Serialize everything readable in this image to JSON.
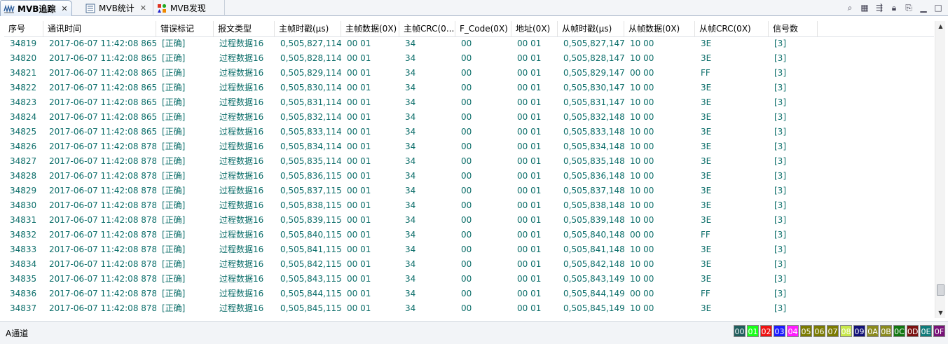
{
  "tabs": [
    {
      "label": "MVB追踪",
      "icon": "trace-wave-icon",
      "active": true
    },
    {
      "label": "MVB统计",
      "icon": "statistics-table-icon",
      "active": false
    },
    {
      "label": "MVB发现",
      "icon": "discovery-nodes-icon",
      "active": false
    }
  ],
  "toolbar_icons": [
    "search-icon",
    "table-view-icon",
    "filter-icon",
    "lock-icon",
    "export-icon",
    "minimize-icon",
    "maximize-icon"
  ],
  "columns": [
    "序号",
    "通讯时间",
    "错误标记",
    "报文类型",
    "主帧时戳(μs)",
    "主帧数据(0X)",
    "主帧CRC(0...",
    "F_Code(0X)",
    "地址(0X)",
    "从帧时戳(μs)",
    "从帧数据(0X)",
    "从帧CRC(0X)",
    "信号数"
  ],
  "rows": [
    [
      "34819",
      "2017-06-07 11:42:08 865",
      "[正确]",
      "过程数据16",
      "0,505,827,114",
      "00 01",
      "34",
      "00",
      "00 01",
      "0,505,827,147",
      "10 00",
      "3E",
      "[3]"
    ],
    [
      "34820",
      "2017-06-07 11:42:08 865",
      "[正确]",
      "过程数据16",
      "0,505,828,114",
      "00 01",
      "34",
      "00",
      "00 01",
      "0,505,828,147",
      "10 00",
      "3E",
      "[3]"
    ],
    [
      "34821",
      "2017-06-07 11:42:08 865",
      "[正确]",
      "过程数据16",
      "0,505,829,114",
      "00 01",
      "34",
      "00",
      "00 01",
      "0,505,829,147",
      "00 00",
      "FF",
      "[3]"
    ],
    [
      "34822",
      "2017-06-07 11:42:08 865",
      "[正确]",
      "过程数据16",
      "0,505,830,114",
      "00 01",
      "34",
      "00",
      "00 01",
      "0,505,830,147",
      "10 00",
      "3E",
      "[3]"
    ],
    [
      "34823",
      "2017-06-07 11:42:08 865",
      "[正确]",
      "过程数据16",
      "0,505,831,114",
      "00 01",
      "34",
      "00",
      "00 01",
      "0,505,831,147",
      "10 00",
      "3E",
      "[3]"
    ],
    [
      "34824",
      "2017-06-07 11:42:08 865",
      "[正确]",
      "过程数据16",
      "0,505,832,114",
      "00 01",
      "34",
      "00",
      "00 01",
      "0,505,832,148",
      "10 00",
      "3E",
      "[3]"
    ],
    [
      "34825",
      "2017-06-07 11:42:08 865",
      "[正确]",
      "过程数据16",
      "0,505,833,114",
      "00 01",
      "34",
      "00",
      "00 01",
      "0,505,833,148",
      "10 00",
      "3E",
      "[3]"
    ],
    [
      "34826",
      "2017-06-07 11:42:08 878",
      "[正确]",
      "过程数据16",
      "0,505,834,114",
      "00 01",
      "34",
      "00",
      "00 01",
      "0,505,834,148",
      "10 00",
      "3E",
      "[3]"
    ],
    [
      "34827",
      "2017-06-07 11:42:08 878",
      "[正确]",
      "过程数据16",
      "0,505,835,114",
      "00 01",
      "34",
      "00",
      "00 01",
      "0,505,835,148",
      "10 00",
      "3E",
      "[3]"
    ],
    [
      "34828",
      "2017-06-07 11:42:08 878",
      "[正确]",
      "过程数据16",
      "0,505,836,115",
      "00 01",
      "34",
      "00",
      "00 01",
      "0,505,836,148",
      "10 00",
      "3E",
      "[3]"
    ],
    [
      "34829",
      "2017-06-07 11:42:08 878",
      "[正确]",
      "过程数据16",
      "0,505,837,115",
      "00 01",
      "34",
      "00",
      "00 01",
      "0,505,837,148",
      "10 00",
      "3E",
      "[3]"
    ],
    [
      "34830",
      "2017-06-07 11:42:08 878",
      "[正确]",
      "过程数据16",
      "0,505,838,115",
      "00 01",
      "34",
      "00",
      "00 01",
      "0,505,838,148",
      "10 00",
      "3E",
      "[3]"
    ],
    [
      "34831",
      "2017-06-07 11:42:08 878",
      "[正确]",
      "过程数据16",
      "0,505,839,115",
      "00 01",
      "34",
      "00",
      "00 01",
      "0,505,839,148",
      "10 00",
      "3E",
      "[3]"
    ],
    [
      "34832",
      "2017-06-07 11:42:08 878",
      "[正确]",
      "过程数据16",
      "0,505,840,115",
      "00 01",
      "34",
      "00",
      "00 01",
      "0,505,840,148",
      "00 00",
      "FF",
      "[3]"
    ],
    [
      "34833",
      "2017-06-07 11:42:08 878",
      "[正确]",
      "过程数据16",
      "0,505,841,115",
      "00 01",
      "34",
      "00",
      "00 01",
      "0,505,841,148",
      "10 00",
      "3E",
      "[3]"
    ],
    [
      "34834",
      "2017-06-07 11:42:08 878",
      "[正确]",
      "过程数据16",
      "0,505,842,115",
      "00 01",
      "34",
      "00",
      "00 01",
      "0,505,842,148",
      "10 00",
      "3E",
      "[3]"
    ],
    [
      "34835",
      "2017-06-07 11:42:08 878",
      "[正确]",
      "过程数据16",
      "0,505,843,115",
      "00 01",
      "34",
      "00",
      "00 01",
      "0,505,843,149",
      "10 00",
      "3E",
      "[3]"
    ],
    [
      "34836",
      "2017-06-07 11:42:08 878",
      "[正确]",
      "过程数据16",
      "0,505,844,115",
      "00 01",
      "34",
      "00",
      "00 01",
      "0,505,844,149",
      "00 00",
      "FF",
      "[3]"
    ],
    [
      "34837",
      "2017-06-07 11:42:08 878",
      "[正确]",
      "过程数据16",
      "0,505,845,115",
      "00 01",
      "34",
      "00",
      "00 01",
      "0,505,845,149",
      "10 00",
      "3E",
      "[3]"
    ]
  ],
  "status": {
    "channel": "A通道",
    "codes": [
      {
        "label": "00",
        "bg": "#1f5d5d",
        "fg": "#ffffff"
      },
      {
        "label": "01",
        "bg": "#18ff18",
        "fg": "#ffffff"
      },
      {
        "label": "02",
        "bg": "#ee1111",
        "fg": "#ffffff"
      },
      {
        "label": "03",
        "bg": "#1a1aff",
        "fg": "#ffffff"
      },
      {
        "label": "04",
        "bg": "#ff1aff",
        "fg": "#ffffff"
      },
      {
        "label": "05",
        "bg": "#7a7a00",
        "fg": "#ffffff"
      },
      {
        "label": "06",
        "bg": "#7a7a00",
        "fg": "#ffffff"
      },
      {
        "label": "07",
        "bg": "#7a7a00",
        "fg": "#ffffff"
      },
      {
        "label": "08",
        "bg": "#c8e84a",
        "fg": "#ffffff"
      },
      {
        "label": "09",
        "bg": "#111177",
        "fg": "#ffffff"
      },
      {
        "label": "0A",
        "bg": "#8a8a1e",
        "fg": "#ffffff"
      },
      {
        "label": "0B",
        "bg": "#8a8a1e",
        "fg": "#ffffff"
      },
      {
        "label": "0C",
        "bg": "#117711",
        "fg": "#ffffff"
      },
      {
        "label": "0D",
        "bg": "#7a1111",
        "fg": "#ffffff"
      },
      {
        "label": "0E",
        "bg": "#0e7a7a",
        "fg": "#ffffff"
      },
      {
        "label": "0F",
        "bg": "#771177",
        "fg": "#ffffff"
      }
    ]
  },
  "colors": {
    "row_text": "#0c6e6a",
    "header_text": "#000000",
    "tab_border": "#99adc6"
  }
}
